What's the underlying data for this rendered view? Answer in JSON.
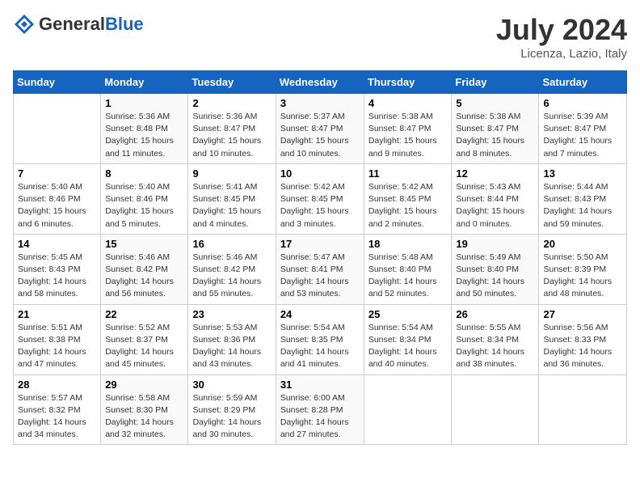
{
  "header": {
    "logo_general": "General",
    "logo_blue": "Blue",
    "month_title": "July 2024",
    "location": "Licenza, Lazio, Italy"
  },
  "weekdays": [
    "Sunday",
    "Monday",
    "Tuesday",
    "Wednesday",
    "Thursday",
    "Friday",
    "Saturday"
  ],
  "weeks": [
    [
      {
        "day": "",
        "sunrise": "",
        "sunset": "",
        "daylight": ""
      },
      {
        "day": "1",
        "sunrise": "Sunrise: 5:36 AM",
        "sunset": "Sunset: 8:48 PM",
        "daylight": "Daylight: 15 hours and 11 minutes."
      },
      {
        "day": "2",
        "sunrise": "Sunrise: 5:36 AM",
        "sunset": "Sunset: 8:47 PM",
        "daylight": "Daylight: 15 hours and 10 minutes."
      },
      {
        "day": "3",
        "sunrise": "Sunrise: 5:37 AM",
        "sunset": "Sunset: 8:47 PM",
        "daylight": "Daylight: 15 hours and 10 minutes."
      },
      {
        "day": "4",
        "sunrise": "Sunrise: 5:38 AM",
        "sunset": "Sunset: 8:47 PM",
        "daylight": "Daylight: 15 hours and 9 minutes."
      },
      {
        "day": "5",
        "sunrise": "Sunrise: 5:38 AM",
        "sunset": "Sunset: 8:47 PM",
        "daylight": "Daylight: 15 hours and 8 minutes."
      },
      {
        "day": "6",
        "sunrise": "Sunrise: 5:39 AM",
        "sunset": "Sunset: 8:47 PM",
        "daylight": "Daylight: 15 hours and 7 minutes."
      }
    ],
    [
      {
        "day": "7",
        "sunrise": "Sunrise: 5:40 AM",
        "sunset": "Sunset: 8:46 PM",
        "daylight": "Daylight: 15 hours and 6 minutes."
      },
      {
        "day": "8",
        "sunrise": "Sunrise: 5:40 AM",
        "sunset": "Sunset: 8:46 PM",
        "daylight": "Daylight: 15 hours and 5 minutes."
      },
      {
        "day": "9",
        "sunrise": "Sunrise: 5:41 AM",
        "sunset": "Sunset: 8:45 PM",
        "daylight": "Daylight: 15 hours and 4 minutes."
      },
      {
        "day": "10",
        "sunrise": "Sunrise: 5:42 AM",
        "sunset": "Sunset: 8:45 PM",
        "daylight": "Daylight: 15 hours and 3 minutes."
      },
      {
        "day": "11",
        "sunrise": "Sunrise: 5:42 AM",
        "sunset": "Sunset: 8:45 PM",
        "daylight": "Daylight: 15 hours and 2 minutes."
      },
      {
        "day": "12",
        "sunrise": "Sunrise: 5:43 AM",
        "sunset": "Sunset: 8:44 PM",
        "daylight": "Daylight: 15 hours and 0 minutes."
      },
      {
        "day": "13",
        "sunrise": "Sunrise: 5:44 AM",
        "sunset": "Sunset: 8:43 PM",
        "daylight": "Daylight: 14 hours and 59 minutes."
      }
    ],
    [
      {
        "day": "14",
        "sunrise": "Sunrise: 5:45 AM",
        "sunset": "Sunset: 8:43 PM",
        "daylight": "Daylight: 14 hours and 58 minutes."
      },
      {
        "day": "15",
        "sunrise": "Sunrise: 5:46 AM",
        "sunset": "Sunset: 8:42 PM",
        "daylight": "Daylight: 14 hours and 56 minutes."
      },
      {
        "day": "16",
        "sunrise": "Sunrise: 5:46 AM",
        "sunset": "Sunset: 8:42 PM",
        "daylight": "Daylight: 14 hours and 55 minutes."
      },
      {
        "day": "17",
        "sunrise": "Sunrise: 5:47 AM",
        "sunset": "Sunset: 8:41 PM",
        "daylight": "Daylight: 14 hours and 53 minutes."
      },
      {
        "day": "18",
        "sunrise": "Sunrise: 5:48 AM",
        "sunset": "Sunset: 8:40 PM",
        "daylight": "Daylight: 14 hours and 52 minutes."
      },
      {
        "day": "19",
        "sunrise": "Sunrise: 5:49 AM",
        "sunset": "Sunset: 8:40 PM",
        "daylight": "Daylight: 14 hours and 50 minutes."
      },
      {
        "day": "20",
        "sunrise": "Sunrise: 5:50 AM",
        "sunset": "Sunset: 8:39 PM",
        "daylight": "Daylight: 14 hours and 48 minutes."
      }
    ],
    [
      {
        "day": "21",
        "sunrise": "Sunrise: 5:51 AM",
        "sunset": "Sunset: 8:38 PM",
        "daylight": "Daylight: 14 hours and 47 minutes."
      },
      {
        "day": "22",
        "sunrise": "Sunrise: 5:52 AM",
        "sunset": "Sunset: 8:37 PM",
        "daylight": "Daylight: 14 hours and 45 minutes."
      },
      {
        "day": "23",
        "sunrise": "Sunrise: 5:53 AM",
        "sunset": "Sunset: 8:36 PM",
        "daylight": "Daylight: 14 hours and 43 minutes."
      },
      {
        "day": "24",
        "sunrise": "Sunrise: 5:54 AM",
        "sunset": "Sunset: 8:35 PM",
        "daylight": "Daylight: 14 hours and 41 minutes."
      },
      {
        "day": "25",
        "sunrise": "Sunrise: 5:54 AM",
        "sunset": "Sunset: 8:34 PM",
        "daylight": "Daylight: 14 hours and 40 minutes."
      },
      {
        "day": "26",
        "sunrise": "Sunrise: 5:55 AM",
        "sunset": "Sunset: 8:34 PM",
        "daylight": "Daylight: 14 hours and 38 minutes."
      },
      {
        "day": "27",
        "sunrise": "Sunrise: 5:56 AM",
        "sunset": "Sunset: 8:33 PM",
        "daylight": "Daylight: 14 hours and 36 minutes."
      }
    ],
    [
      {
        "day": "28",
        "sunrise": "Sunrise: 5:57 AM",
        "sunset": "Sunset: 8:32 PM",
        "daylight": "Daylight: 14 hours and 34 minutes."
      },
      {
        "day": "29",
        "sunrise": "Sunrise: 5:58 AM",
        "sunset": "Sunset: 8:30 PM",
        "daylight": "Daylight: 14 hours and 32 minutes."
      },
      {
        "day": "30",
        "sunrise": "Sunrise: 5:59 AM",
        "sunset": "Sunset: 8:29 PM",
        "daylight": "Daylight: 14 hours and 30 minutes."
      },
      {
        "day": "31",
        "sunrise": "Sunrise: 6:00 AM",
        "sunset": "Sunset: 8:28 PM",
        "daylight": "Daylight: 14 hours and 27 minutes."
      },
      {
        "day": "",
        "sunrise": "",
        "sunset": "",
        "daylight": ""
      },
      {
        "day": "",
        "sunrise": "",
        "sunset": "",
        "daylight": ""
      },
      {
        "day": "",
        "sunrise": "",
        "sunset": "",
        "daylight": ""
      }
    ]
  ]
}
